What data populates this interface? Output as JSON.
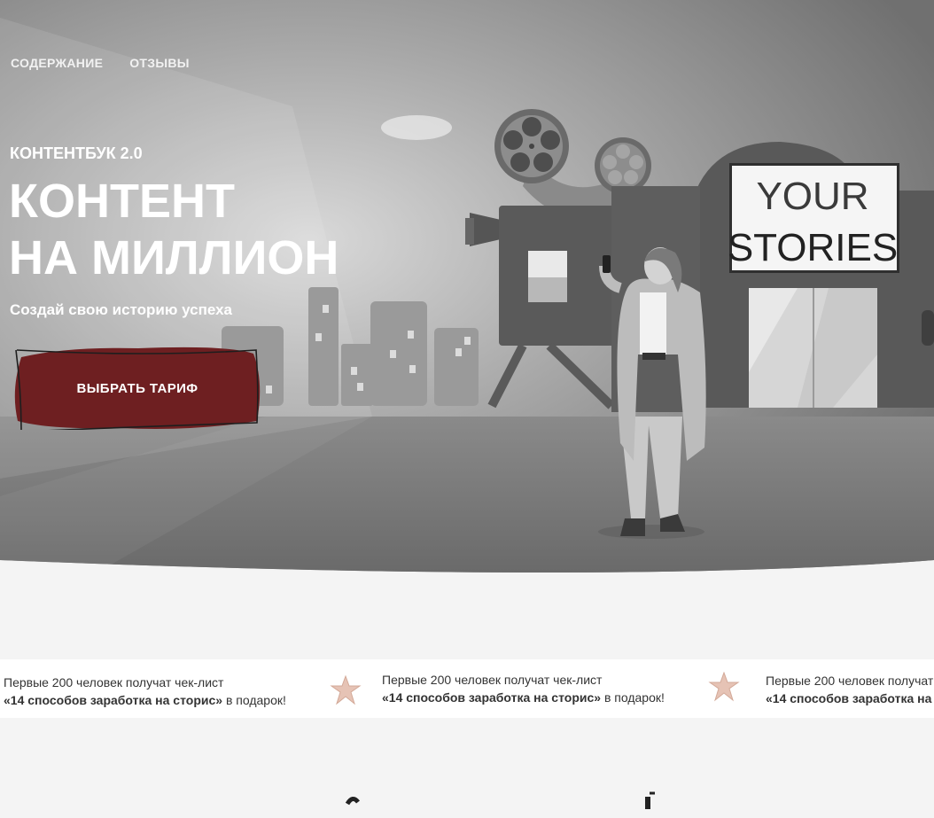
{
  "nav": {
    "items": [
      "СОДЕРЖАНИЕ",
      "ОТЗЫВЫ"
    ]
  },
  "hero": {
    "eyebrow": "КОНТЕНТБУК 2.0",
    "title_line1": "КОНТЕНТ",
    "title_line2": "НА МИЛЛИОН",
    "subtitle_pre": "Создай свою ",
    "subtitle_bold": "историю успеха",
    "cta_label": "ВЫБРАТЬ ТАРИФ",
    "sign_line1": "YOUR",
    "sign_line2": "STORIES"
  },
  "ticker": {
    "line1": "Первые 200 человек получат чек-лист",
    "bold": "«14 способов заработка на сторис»",
    "suffix": " в подарок!"
  },
  "colors": {
    "accent": "#6e1f21",
    "star": "#e6c3b5"
  }
}
